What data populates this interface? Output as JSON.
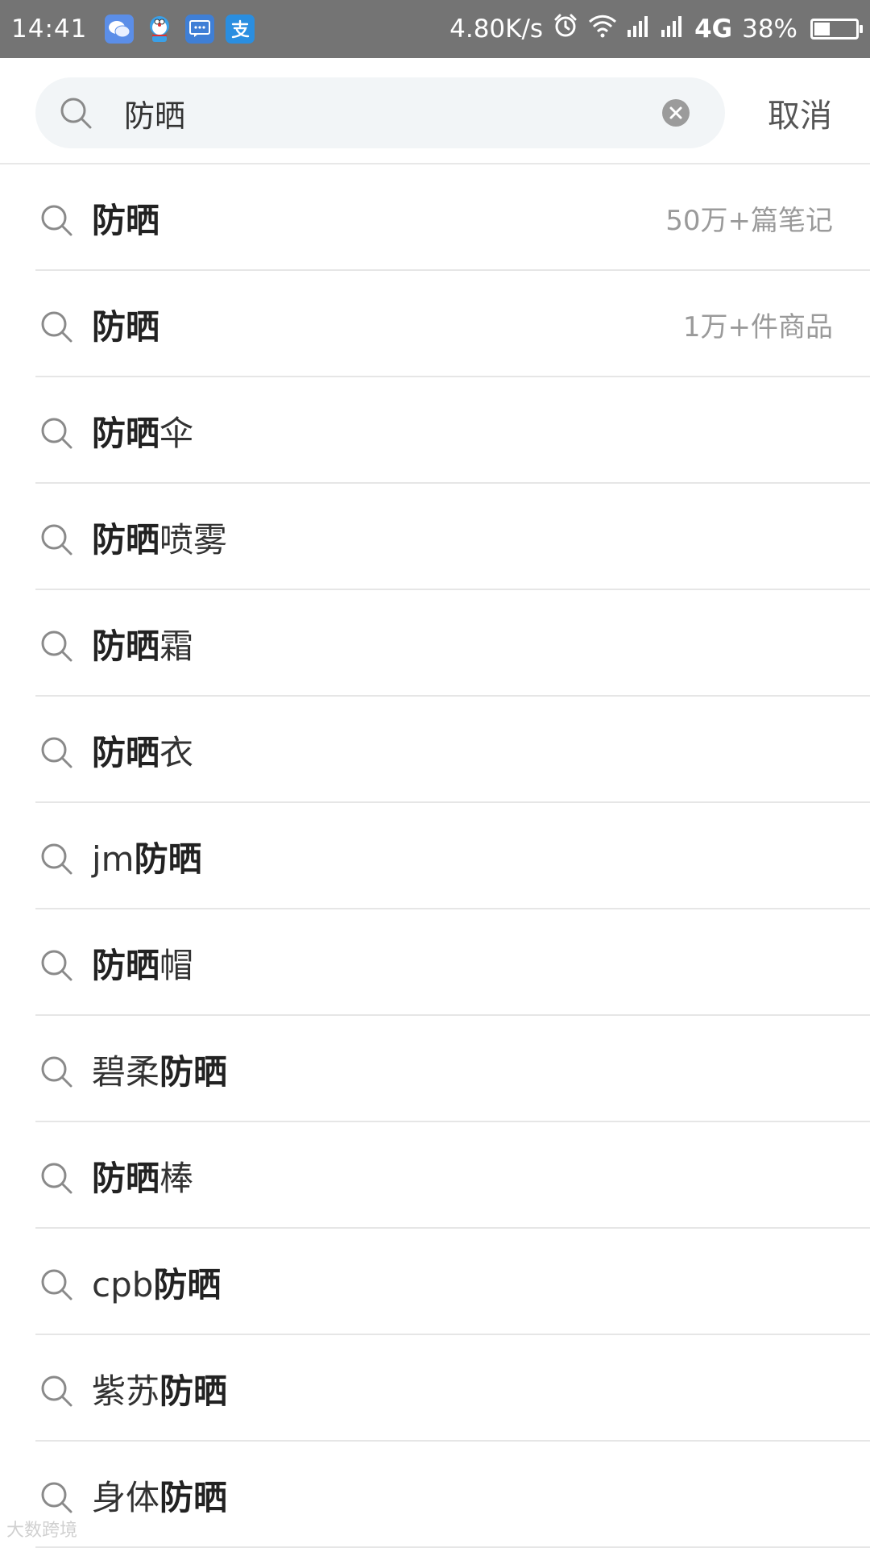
{
  "status_bar": {
    "time": "14:41",
    "notifications": [
      "wechat-icon",
      "doraemon-icon",
      "message-icon",
      "alipay-icon"
    ],
    "net_speed": "4.80K/s",
    "network": "4G",
    "battery": "38%",
    "battery_level": 0.38
  },
  "search": {
    "query": "防晒",
    "cancel_label": "取消"
  },
  "suggestions": [
    {
      "pre": "",
      "hl": "防晒",
      "post": "",
      "meta": "50万+篇笔记"
    },
    {
      "pre": "",
      "hl": "防晒",
      "post": "",
      "meta": "1万+件商品"
    },
    {
      "pre": "",
      "hl": "防晒",
      "post": "伞",
      "meta": ""
    },
    {
      "pre": "",
      "hl": "防晒",
      "post": "喷雾",
      "meta": ""
    },
    {
      "pre": "",
      "hl": "防晒",
      "post": "霜",
      "meta": ""
    },
    {
      "pre": "",
      "hl": "防晒",
      "post": "衣",
      "meta": ""
    },
    {
      "pre": "jm",
      "hl": "防晒",
      "post": "",
      "meta": ""
    },
    {
      "pre": "",
      "hl": "防晒",
      "post": "帽",
      "meta": ""
    },
    {
      "pre": "碧柔",
      "hl": "防晒",
      "post": "",
      "meta": ""
    },
    {
      "pre": "",
      "hl": "防晒",
      "post": "棒",
      "meta": ""
    },
    {
      "pre": "cpb",
      "hl": "防晒",
      "post": "",
      "meta": ""
    },
    {
      "pre": "紫苏",
      "hl": "防晒",
      "post": "",
      "meta": ""
    },
    {
      "pre": "身体",
      "hl": "防晒",
      "post": "",
      "meta": ""
    }
  ],
  "watermark": "大数跨境"
}
